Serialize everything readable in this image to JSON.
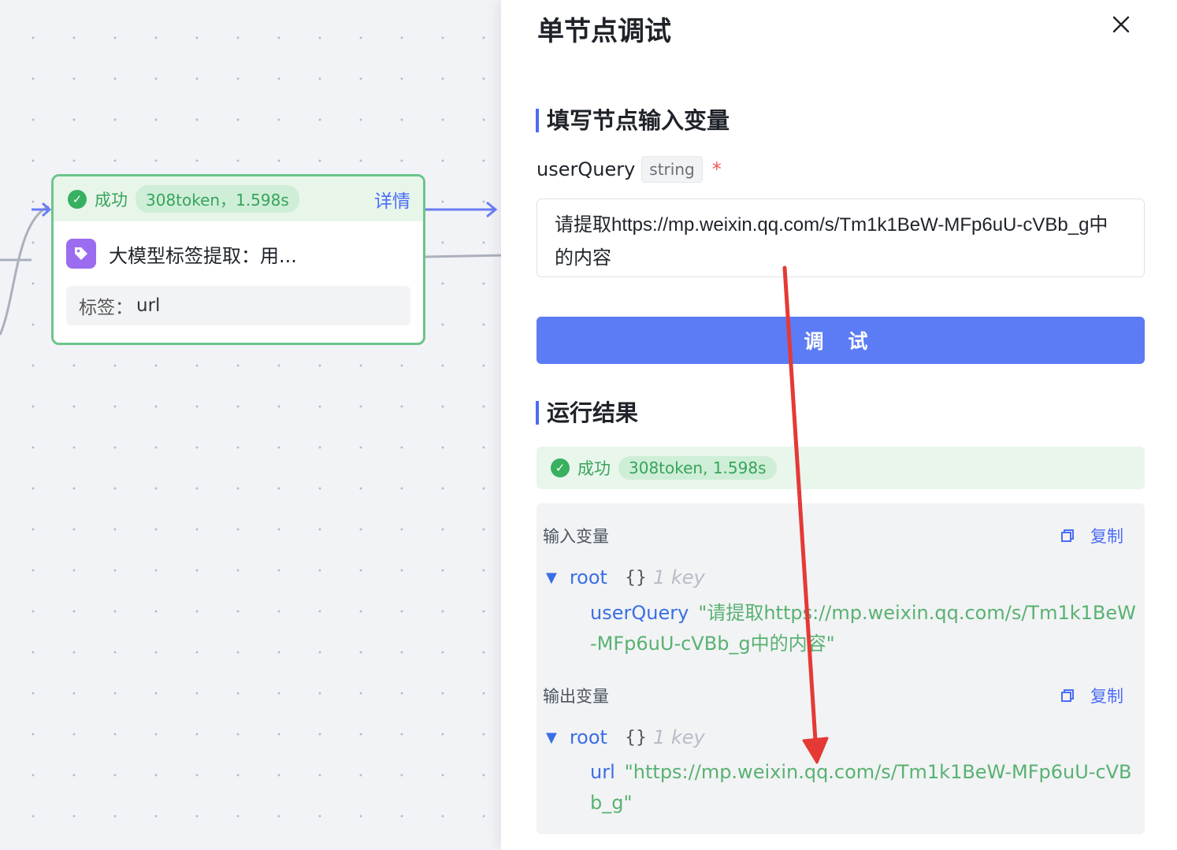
{
  "canvas": {
    "node": {
      "status": "成功",
      "token_info": "308token，1.598s",
      "detail_link": "详情",
      "title": "大模型标签提取：用...",
      "tag_label": "标签：",
      "tag_value": "url"
    }
  },
  "panel": {
    "title": "单节点调试",
    "input_section_title": "填写节点输入变量",
    "variable": {
      "name": "userQuery",
      "type": "string",
      "required_mark": "*",
      "value": "请提取https://mp.weixin.qq.com/s/Tm1k1BeW-MFp6uU-cVBb_g中的内容"
    },
    "debug_button": "调 试",
    "result_section_title": "运行结果",
    "result": {
      "status": "成功",
      "token_info": "308token, 1.598s",
      "input_vars": {
        "heading": "输入变量",
        "copy_label": "复制",
        "root_key": "root",
        "braces": "{}",
        "key_count": "1 key",
        "entry_key": "userQuery",
        "entry_value": "\"请提取https://mp.weixin.qq.com/s/Tm1k1BeW-MFp6uU-cVBb_g中的内容\""
      },
      "output_vars": {
        "heading": "输出变量",
        "copy_label": "复制",
        "root_key": "root",
        "braces": "{}",
        "key_count": "1 key",
        "entry_key": "url",
        "entry_value": "\"https://mp.weixin.qq.com/s/Tm1k1BeW-MFp6uU-cVBb_g\""
      }
    }
  },
  "colors": {
    "accent": "#5b7cf5",
    "success": "#37b05f",
    "annotation_arrow": "#e53935"
  }
}
